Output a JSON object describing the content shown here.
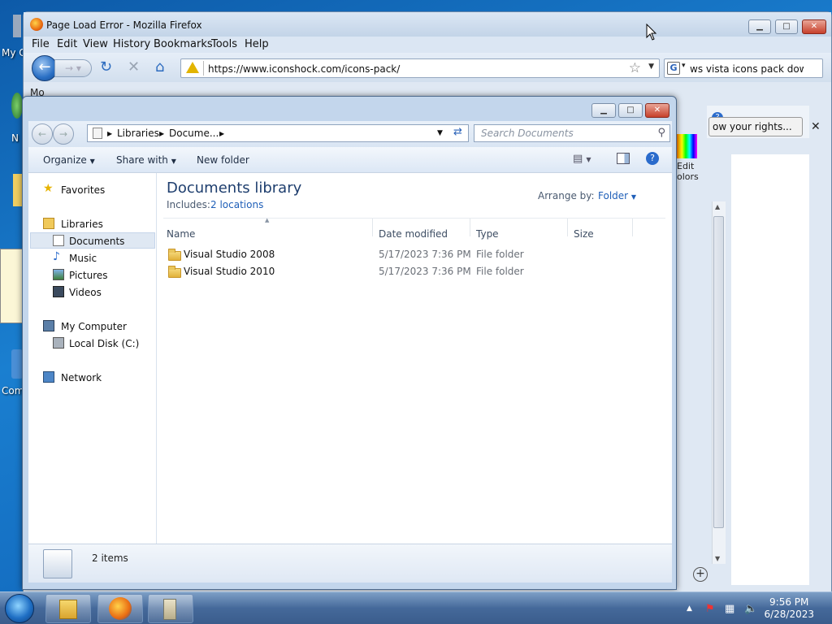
{
  "desktop": {
    "icons": [
      {
        "label": "My C"
      },
      {
        "label": "N"
      },
      {
        "label": "Com"
      }
    ]
  },
  "firefox": {
    "title": "Page Load Error - Mozilla Firefox",
    "menu": [
      "File",
      "Edit",
      "View",
      "History",
      "Bookmarks",
      "Tools",
      "Help"
    ],
    "url": "https://www.iconshock.com/icons-pack/",
    "search_text": "ws vista icons pack downlo",
    "bookmark_partial": "Mo",
    "notification": "ow your rights...",
    "edit_colors": "Edit\nolors"
  },
  "explorer": {
    "breadcrumb": [
      "Libraries",
      "Docume..."
    ],
    "search_placeholder": "Search Documents",
    "toolbar": {
      "organize": "Organize",
      "share": "Share with",
      "new_folder": "New folder"
    },
    "sidebar": {
      "favorites": "Favorites",
      "libraries": "Libraries",
      "documents": "Documents",
      "music": "Music",
      "pictures": "Pictures",
      "videos": "Videos",
      "my_computer": "My Computer",
      "local_disk": "Local Disk (C:)",
      "network": "Network"
    },
    "library_title": "Documents library",
    "includes_label": "Includes:",
    "includes_link": "2 locations",
    "arrange_label": "Arrange by:",
    "arrange_value": "Folder",
    "columns": {
      "name": "Name",
      "date": "Date modified",
      "type": "Type",
      "size": "Size"
    },
    "rows": [
      {
        "name": "Visual Studio 2008",
        "date": "5/17/2023 7:36 PM",
        "type": "File folder"
      },
      {
        "name": "Visual Studio 2010",
        "date": "5/17/2023 7:36 PM",
        "type": "File folder"
      }
    ],
    "status": "2 items"
  },
  "taskbar": {
    "time": "9:56 PM",
    "date": "6/28/2023"
  }
}
